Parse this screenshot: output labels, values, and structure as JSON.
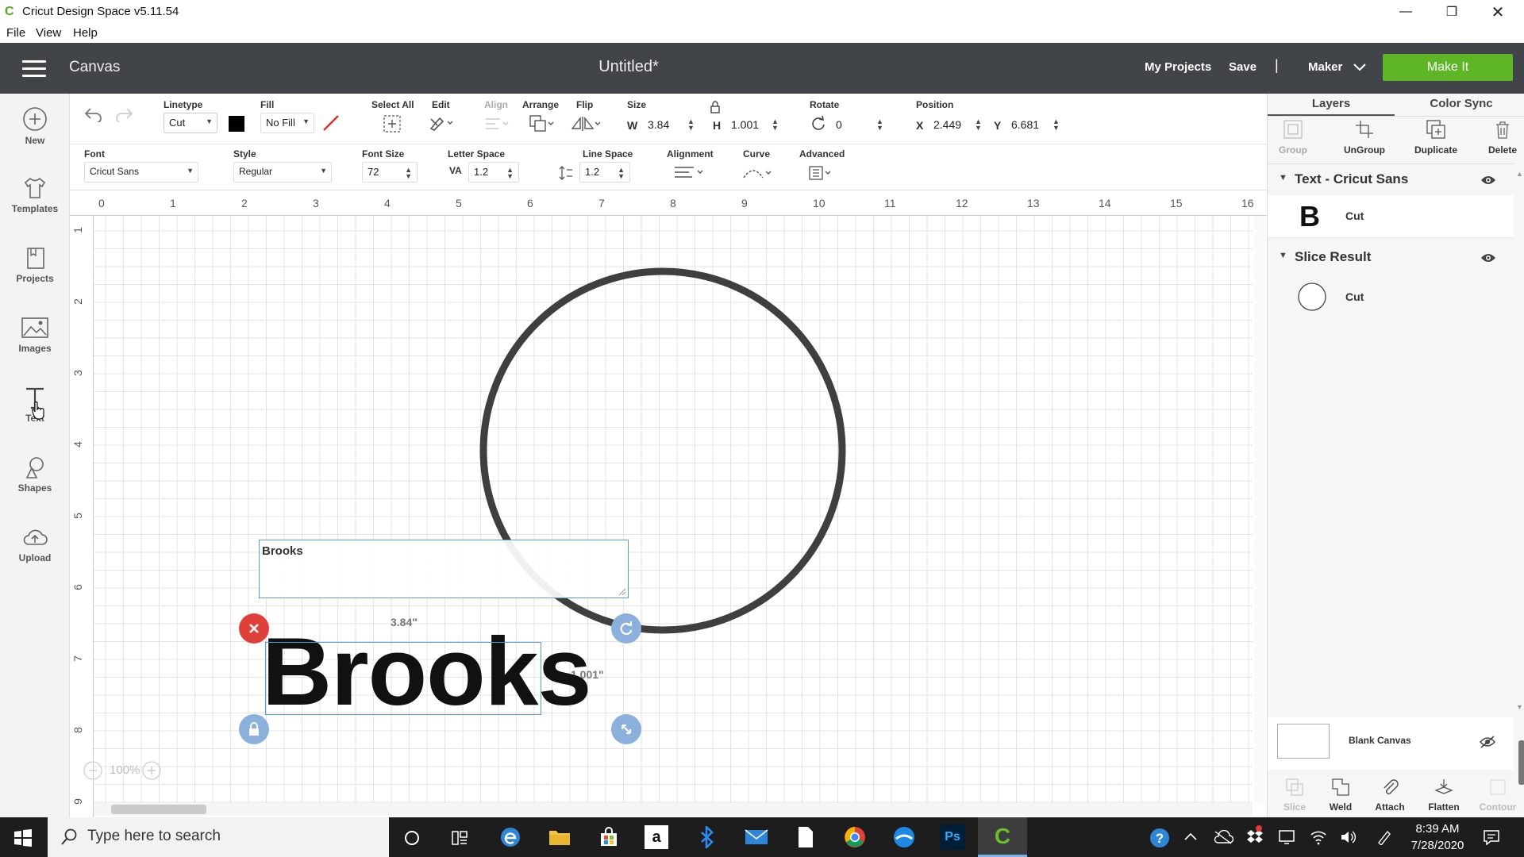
{
  "window": {
    "title": "Cricut Design Space  v5.11.54",
    "icon": "cricut-c-icon"
  },
  "menu": [
    "File",
    "View",
    "Help"
  ],
  "header": {
    "section": "Canvas",
    "doc_title": "Untitled*",
    "my_projects": "My Projects",
    "save": "Save",
    "separator": "|",
    "machine": "Maker",
    "make_it": "Make It"
  },
  "sidebar": [
    {
      "label": "New",
      "icon": "plus-circle-icon"
    },
    {
      "label": "Templates",
      "icon": "tshirt-icon"
    },
    {
      "label": "Projects",
      "icon": "projects-icon"
    },
    {
      "label": "Images",
      "icon": "image-icon"
    },
    {
      "label": "Text",
      "icon": "text-icon"
    },
    {
      "label": "Shapes",
      "icon": "shapes-icon"
    },
    {
      "label": "Upload",
      "icon": "cloud-upload-icon"
    }
  ],
  "toolbar": {
    "linetype_label": "Linetype",
    "linetype_value": "Cut",
    "fill_label": "Fill",
    "fill_value": "No Fill",
    "select_all": "Select All",
    "edit": "Edit",
    "align": "Align",
    "arrange": "Arrange",
    "flip": "Flip",
    "size_label": "Size",
    "w_label": "W",
    "w_value": "3.84",
    "h_label": "H",
    "h_value": "1.001",
    "rotate_label": "Rotate",
    "rotate_value": "0",
    "position_label": "Position",
    "x_label": "X",
    "x_value": "2.449",
    "y_label": "Y",
    "y_value": "6.681",
    "linetype_color": "#000000"
  },
  "text_toolbar": {
    "font_label": "Font",
    "font_value": "Cricut Sans",
    "style_label": "Style",
    "style_value": "Regular",
    "font_size_label": "Font Size",
    "font_size_value": "72",
    "letter_space_label": "Letter Space",
    "letter_space_value": "1.2",
    "line_space_label": "Line Space",
    "line_space_value": "1.2",
    "alignment_label": "Alignment",
    "curve_label": "Curve",
    "advanced_label": "Advanced"
  },
  "canvas": {
    "ruler_top": [
      "0",
      "1",
      "2",
      "3",
      "4",
      "5",
      "6",
      "7",
      "8",
      "9",
      "10",
      "11",
      "12",
      "13",
      "14",
      "15",
      "16"
    ],
    "ruler_left": [
      "1",
      "2",
      "3",
      "4",
      "5",
      "6",
      "7",
      "8",
      "9"
    ],
    "textbox_value": "Brooks",
    "text_object": "Brooks",
    "width_label": "3.84\"",
    "height_label": "1.001\"",
    "zoom": "100%"
  },
  "rpanel": {
    "tab_layers": "Layers",
    "tab_color_sync": "Color Sync",
    "actions": [
      "Group",
      "UnGroup",
      "Duplicate",
      "Delete"
    ],
    "layer_groups": [
      {
        "title": "Text - Cricut Sans",
        "item_glyph": "B",
        "item_label": "Cut"
      },
      {
        "title": "Slice Result",
        "item_label": "Cut"
      }
    ],
    "blank_canvas": "Blank Canvas",
    "bottom_actions": [
      "Slice",
      "Weld",
      "Attach",
      "Flatten",
      "Contour"
    ]
  },
  "taskbar": {
    "search_placeholder": "Type here to search",
    "time": "8:39 AM",
    "date": "7/28/2020"
  }
}
